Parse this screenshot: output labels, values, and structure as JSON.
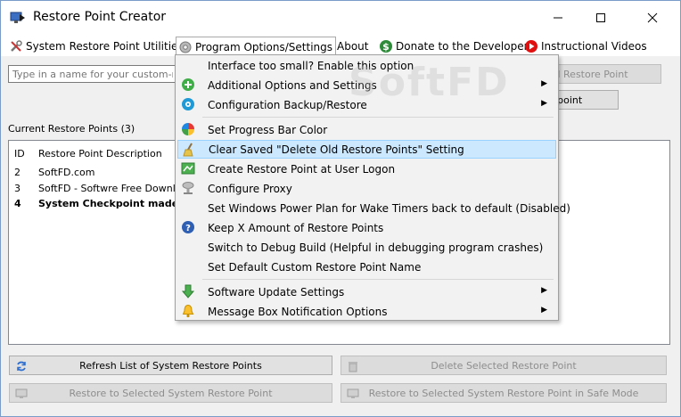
{
  "window": {
    "title": "Restore Point Creator"
  },
  "menubar": {
    "items": [
      {
        "label": "System Restore Point Utilities",
        "icon": "tools-icon"
      },
      {
        "label": "Program Options/Settings",
        "icon": "gear-icon"
      },
      {
        "label": "About"
      },
      {
        "label": "Donate to the Developer",
        "icon": "dollar-icon"
      },
      {
        "label": "Instructional Videos",
        "icon": "play-icon"
      }
    ]
  },
  "toolbar": {
    "name_placeholder": "Type in a name for your custom-named System Restore Point",
    "create_named_label": "Create Custom Named Restore Point",
    "create_checkpoint_label": "Create System Checkpoint"
  },
  "restore_points": {
    "label": "Current Restore Points (3)",
    "columns": [
      "ID",
      "Restore Point Description"
    ],
    "rows": [
      {
        "id": "2",
        "description": "SoftFD.com",
        "bold": false
      },
      {
        "id": "3",
        "description": "SoftFD - Softwre Free Download",
        "bold": false
      },
      {
        "id": "4",
        "description": "System Checkpoint made by",
        "bold": true
      }
    ]
  },
  "buttons": {
    "refresh": "Refresh List of System Restore Points",
    "delete": "Delete Selected Restore Point",
    "restore": "Restore to Selected System Restore Point",
    "restore_safe": "Restore to Selected System Restore Point in Safe Mode"
  },
  "dropdown": {
    "items": [
      {
        "label": "Interface too small? Enable this option",
        "submenu": false
      },
      {
        "label": "Additional Options and Settings",
        "submenu": true,
        "icon": "plus-icon"
      },
      {
        "label": "Configuration Backup/Restore",
        "submenu": true,
        "icon": "backup-icon"
      },
      {
        "label": "Set Progress Bar Color",
        "submenu": false,
        "icon": "color-wheel-icon"
      },
      {
        "label": "Clear Saved \"Delete Old Restore Points\" Setting",
        "submenu": false,
        "icon": "broom-icon"
      },
      {
        "label": "Create Restore Point at User Logon",
        "submenu": false,
        "icon": "logon-icon"
      },
      {
        "label": "Configure Proxy",
        "submenu": false,
        "icon": "proxy-icon"
      },
      {
        "label": "Set Windows Power Plan for Wake Timers back to default (Disabled)",
        "submenu": false
      },
      {
        "label": "Keep X Amount of Restore Points",
        "submenu": false,
        "icon": "question-icon"
      },
      {
        "label": "Switch to Debug Build (Helpful in debugging program crashes)",
        "submenu": false
      },
      {
        "label": "Set Default Custom Restore Point Name",
        "submenu": false
      },
      {
        "label": "Software Update Settings",
        "submenu": true,
        "icon": "download-arrow-icon"
      },
      {
        "label": "Message Box Notification Options",
        "submenu": true,
        "icon": "bell-icon"
      }
    ]
  },
  "watermark": "SoftFD",
  "colors": {
    "highlight": "#cce8ff",
    "highlight_border": "#99d1ff",
    "donate_green": "#2e8b3a",
    "video_red": "#e01010"
  }
}
